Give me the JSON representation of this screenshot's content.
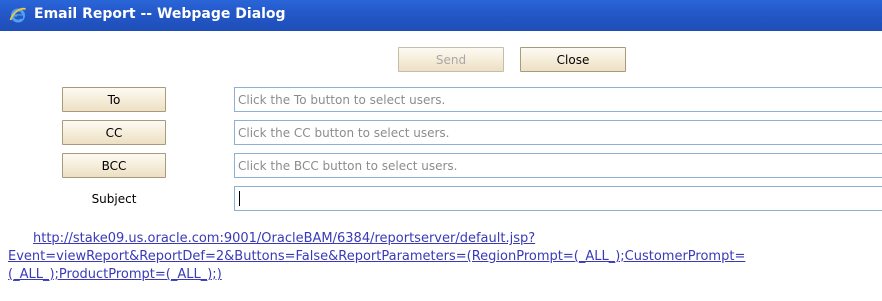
{
  "window": {
    "title": "Email Report -- Webpage Dialog",
    "icon": "ie-icon",
    "titlebar_color": "#2458c9"
  },
  "actions": {
    "send_label": "Send",
    "send_enabled": false,
    "close_label": "Close"
  },
  "recipients": [
    {
      "label": "To",
      "placeholder": "Click the To button to select users."
    },
    {
      "label": "CC",
      "placeholder": "Click the CC button to select users."
    },
    {
      "label": "BCC",
      "placeholder": "Click the BCC button to select users."
    }
  ],
  "subject": {
    "label": "Subject",
    "value": ""
  },
  "report_url": {
    "line1": "http://stake09.us.oracle.com:9001/OracleBAM/6384/reportserver/default.jsp?",
    "line2": "Event=viewReport&ReportDef=2&Buttons=False&ReportParameters=(RegionPrompt=(_ALL_);CustomerPrompt=",
    "line3": "(_ALL_);ProductPrompt=(_ALL_);)"
  }
}
